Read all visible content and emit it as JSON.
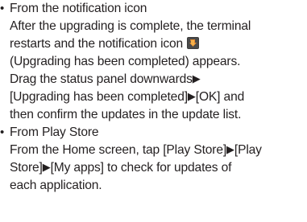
{
  "items": [
    {
      "heading": "From the notification icon",
      "lines": [
        "After the upgrading is complete, the terminal",
        "restarts and the notification icon",
        "(Upgrading has been completed) appears.",
        "Drag the status panel downwards",
        "[Upgrading has been completed]",
        "[OK] and",
        "then confirm the updates in the update list."
      ]
    },
    {
      "heading": "From Play Store",
      "lines": [
        "From the Home screen, tap [Play Store]",
        "[Play",
        "Store]",
        "[My apps] to check for updates of",
        "each application."
      ]
    }
  ],
  "bullet_glyph": "•",
  "arrow_glyph": "▶",
  "notification_icon": "upgrade-complete-notification-icon"
}
